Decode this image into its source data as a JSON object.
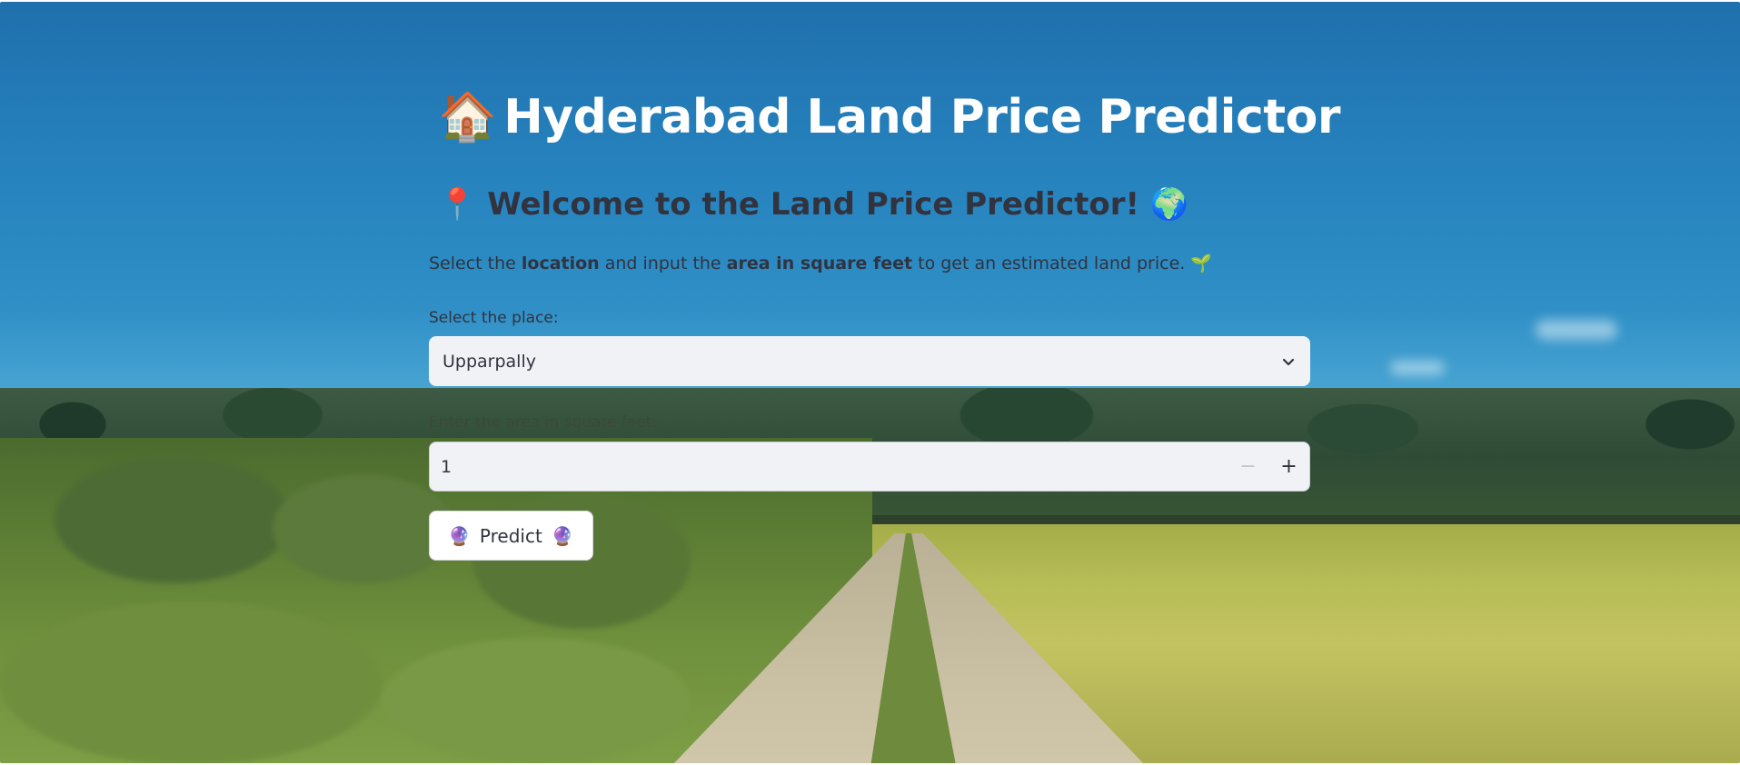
{
  "app": {
    "title": "Hyderabad Land Price Predictor",
    "title_emoji": "🏠",
    "subtitle_left_emoji": "📍",
    "subtitle": "Welcome to the Land Price Predictor!",
    "subtitle_right_emoji": "🌍",
    "description": {
      "part1": "Select the ",
      "bold1": "location",
      "part2": " and input the ",
      "bold2": "area in square feet",
      "part3": " to get an estimated land price.",
      "emoji": "🌱"
    }
  },
  "form": {
    "place_label": "Select the place:",
    "place_value": "Upparpally",
    "area_label": "Enter the area in square feet:",
    "area_value": "1",
    "decrement_icon": "−",
    "increment_icon": "+",
    "predict_emoji_left": "🔮",
    "predict_label": "Predict",
    "predict_emoji_right": "🔮"
  },
  "colors": {
    "text": "#31333f",
    "input_bg": "#f0f2f6",
    "title": "#ffffff"
  },
  "icons": {
    "select_chevron": "chevron-down-icon"
  }
}
